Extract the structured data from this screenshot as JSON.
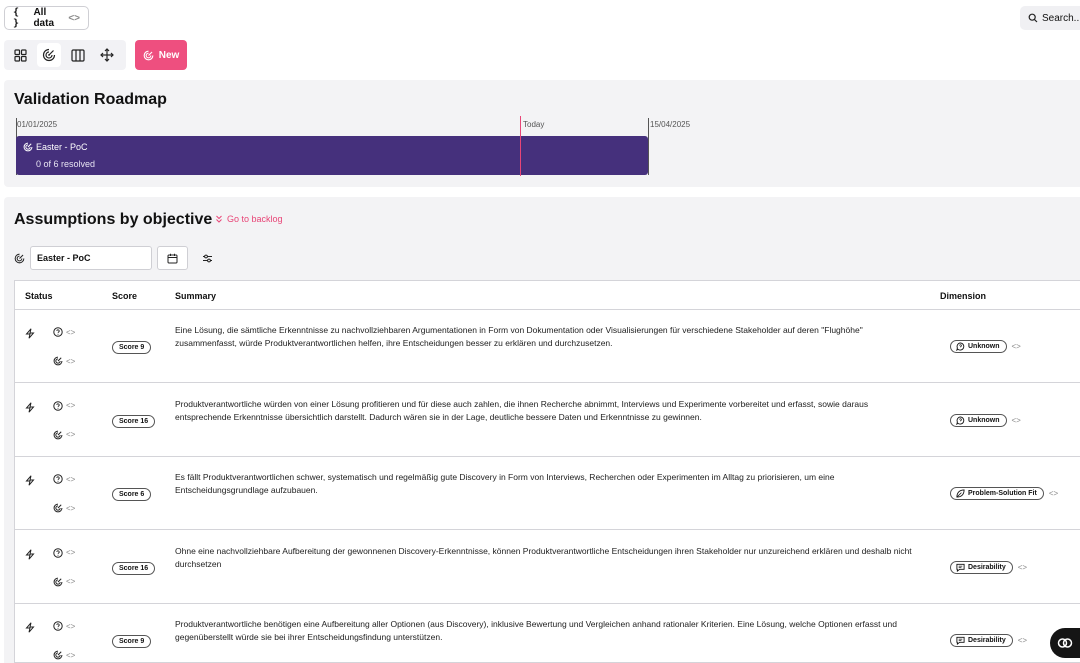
{
  "topbar": {
    "all_data_braces": "{ }",
    "all_data_label": "All data",
    "all_data_code": "<>",
    "search_label": "Search..."
  },
  "toolbar": {
    "tools": [
      "grid-icon",
      "objective-icon",
      "columns-icon",
      "move-icon"
    ],
    "new_label": "New",
    "accent": "#ee4f7f"
  },
  "roadmap": {
    "title": "Validation Roadmap",
    "start_label": "01/01/2025",
    "today_label": "Today",
    "end_label": "15/04/2025",
    "bar_title": "Easter - PoC",
    "bar_subtitle": "0 of 6 resolved",
    "bar_color": "#45307c"
  },
  "assumptions": {
    "title": "Assumptions by objective",
    "backlog_label": "Go to backlog",
    "objective_value": "Easter - PoC",
    "columns": {
      "status": "Status",
      "score": "Score",
      "summary": "Summary",
      "dimension": "Dimension"
    },
    "code_glyph": "<>",
    "rows": [
      {
        "score": "Score 9",
        "summary": "Eine Lösung, die sämtliche Erkenntnisse zu nachvollziehbaren Argumentationen in Form von Dokumentation oder Visualisierungen für verschiedene Stakeholder auf deren \"Flughöhe\" zusammenfasst, würde Produktverantwortlichen helfen, ihre Entscheidungen besser zu erklären und durchzusetzen.",
        "dimension": "Unknown",
        "dimension_icon": "question-bubble-icon"
      },
      {
        "score": "Score 16",
        "summary": "Produktverantwortliche würden von einer Lösung profitieren und für diese auch zahlen, die ihnen Recherche abnimmt, Interviews und Experimente vorbereitet und erfasst, sowie daraus entsprechende Erkenntnisse übersichtlich darstellt. Dadurch wären sie in der Lage, deutliche bessere Daten und Erkenntnisse zu gewinnen.",
        "dimension": "Unknown",
        "dimension_icon": "question-bubble-icon"
      },
      {
        "score": "Score 6",
        "summary": "Es fällt Produktverantwortlichen schwer, systematisch und regelmäßig gute Discovery in Form von Interviews, Recherchen oder Experimenten im Alltag zu priorisieren, um eine Entscheidungsgrundlage aufzubauen.",
        "dimension": "Problem-Solution Fit",
        "dimension_icon": "leaf-icon"
      },
      {
        "score": "Score 16",
        "summary": "Ohne eine nachvollziehbare Aufbereitung der gewonnenen Discovery-Erkenntnisse, können Produktverantwortliche Entscheidungen ihren Stakeholder nur unzureichend erklären und deshalb nicht durchsetzen",
        "dimension": "Desirability",
        "dimension_icon": "message-icon"
      },
      {
        "score": "Score 9",
        "summary": "Produktverantwortliche benötigen eine Aufbereitung aller Optionen (aus Discovery), inklusive Bewertung und Vergleichen anhand rationaler Kriterien. Eine Lösung, welche Optionen erfasst und gegenüberstellt würde sie bei ihrer Entscheidungsfindung unterstützen.",
        "dimension": "Desirability",
        "dimension_icon": "message-icon"
      }
    ]
  }
}
